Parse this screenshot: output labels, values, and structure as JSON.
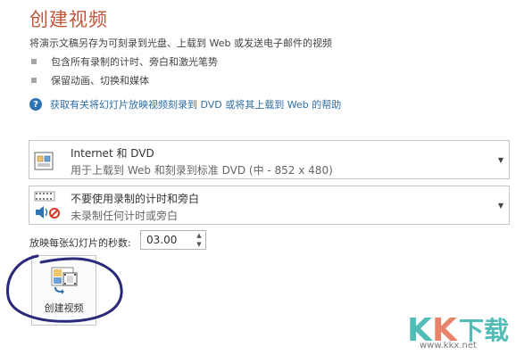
{
  "title": "创建视频",
  "description": "将演示文稿另存为可刻录到光盘、上载到 Web 或发送电子邮件的视频",
  "bullets": [
    "包含所有录制的计时、旁白和激光笔势",
    "保留动画、切换和媒体"
  ],
  "help_link": "获取有关将幻灯片放映视频刻录到 DVD 或将其上载到 Web 的帮助",
  "quality_dropdown": {
    "main": "Internet 和 DVD",
    "sub": "用于上载到 Web 和刻录到标准 DVD (中 - 852 x 480)",
    "icon": "video-quality-icon"
  },
  "timing_dropdown": {
    "main": "不要使用录制的计时和旁白",
    "sub": "未录制任何计时或旁白",
    "icon": "narration-timing-icon"
  },
  "seconds_per_slide": {
    "label": "放映每张幻灯片的秒数:",
    "value": "03.00"
  },
  "create_button": {
    "label": "创建视频",
    "icon": "create-video-icon"
  },
  "watermark": {
    "text": "KK下载",
    "site": "www.kkx.net"
  },
  "colors": {
    "title": "#c2553b",
    "link": "#2e6ea8",
    "annotation_circle": "#2a2a7a",
    "watermark_teal": "#1aa6a0",
    "watermark_red": "#e05a3a"
  }
}
